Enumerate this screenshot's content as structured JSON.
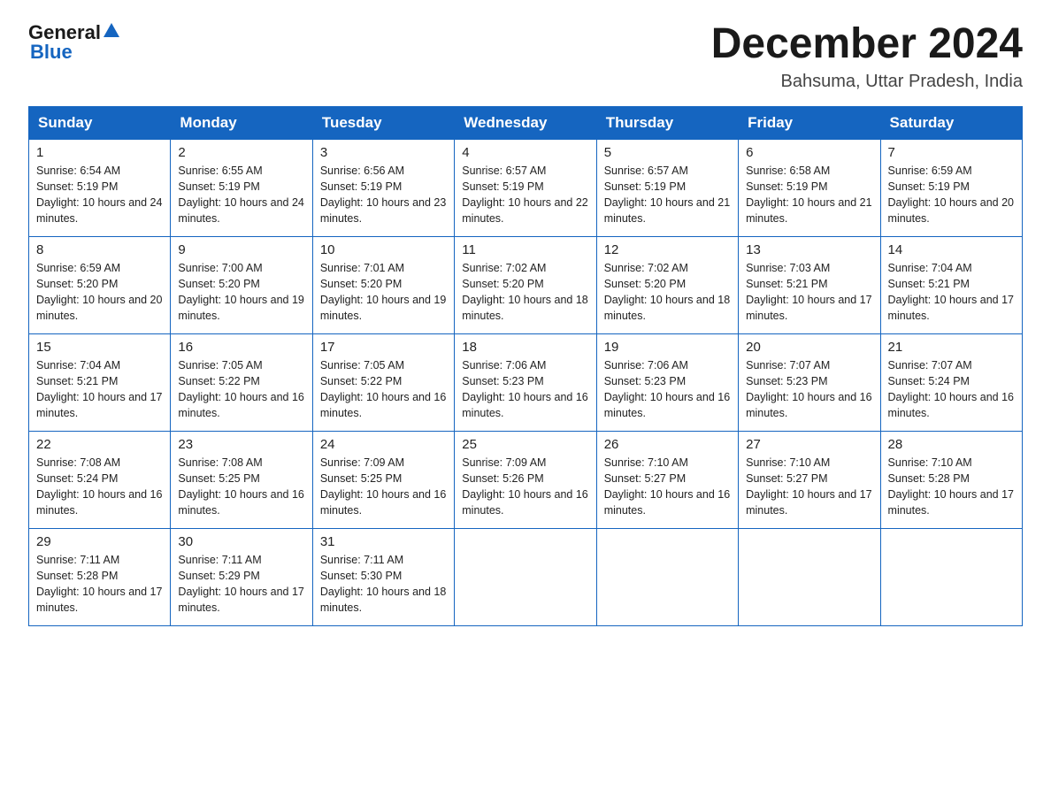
{
  "header": {
    "logo_general": "General",
    "logo_blue": "Blue",
    "title": "December 2024",
    "subtitle": "Bahsuma, Uttar Pradesh, India"
  },
  "days_of_week": [
    "Sunday",
    "Monday",
    "Tuesday",
    "Wednesday",
    "Thursday",
    "Friday",
    "Saturday"
  ],
  "weeks": [
    [
      {
        "day": "1",
        "sunrise": "6:54 AM",
        "sunset": "5:19 PM",
        "daylight": "10 hours and 24 minutes."
      },
      {
        "day": "2",
        "sunrise": "6:55 AM",
        "sunset": "5:19 PM",
        "daylight": "10 hours and 24 minutes."
      },
      {
        "day": "3",
        "sunrise": "6:56 AM",
        "sunset": "5:19 PM",
        "daylight": "10 hours and 23 minutes."
      },
      {
        "day": "4",
        "sunrise": "6:57 AM",
        "sunset": "5:19 PM",
        "daylight": "10 hours and 22 minutes."
      },
      {
        "day": "5",
        "sunrise": "6:57 AM",
        "sunset": "5:19 PM",
        "daylight": "10 hours and 21 minutes."
      },
      {
        "day": "6",
        "sunrise": "6:58 AM",
        "sunset": "5:19 PM",
        "daylight": "10 hours and 21 minutes."
      },
      {
        "day": "7",
        "sunrise": "6:59 AM",
        "sunset": "5:19 PM",
        "daylight": "10 hours and 20 minutes."
      }
    ],
    [
      {
        "day": "8",
        "sunrise": "6:59 AM",
        "sunset": "5:20 PM",
        "daylight": "10 hours and 20 minutes."
      },
      {
        "day": "9",
        "sunrise": "7:00 AM",
        "sunset": "5:20 PM",
        "daylight": "10 hours and 19 minutes."
      },
      {
        "day": "10",
        "sunrise": "7:01 AM",
        "sunset": "5:20 PM",
        "daylight": "10 hours and 19 minutes."
      },
      {
        "day": "11",
        "sunrise": "7:02 AM",
        "sunset": "5:20 PM",
        "daylight": "10 hours and 18 minutes."
      },
      {
        "day": "12",
        "sunrise": "7:02 AM",
        "sunset": "5:20 PM",
        "daylight": "10 hours and 18 minutes."
      },
      {
        "day": "13",
        "sunrise": "7:03 AM",
        "sunset": "5:21 PM",
        "daylight": "10 hours and 17 minutes."
      },
      {
        "day": "14",
        "sunrise": "7:04 AM",
        "sunset": "5:21 PM",
        "daylight": "10 hours and 17 minutes."
      }
    ],
    [
      {
        "day": "15",
        "sunrise": "7:04 AM",
        "sunset": "5:21 PM",
        "daylight": "10 hours and 17 minutes."
      },
      {
        "day": "16",
        "sunrise": "7:05 AM",
        "sunset": "5:22 PM",
        "daylight": "10 hours and 16 minutes."
      },
      {
        "day": "17",
        "sunrise": "7:05 AM",
        "sunset": "5:22 PM",
        "daylight": "10 hours and 16 minutes."
      },
      {
        "day": "18",
        "sunrise": "7:06 AM",
        "sunset": "5:23 PM",
        "daylight": "10 hours and 16 minutes."
      },
      {
        "day": "19",
        "sunrise": "7:06 AM",
        "sunset": "5:23 PM",
        "daylight": "10 hours and 16 minutes."
      },
      {
        "day": "20",
        "sunrise": "7:07 AM",
        "sunset": "5:23 PM",
        "daylight": "10 hours and 16 minutes."
      },
      {
        "day": "21",
        "sunrise": "7:07 AM",
        "sunset": "5:24 PM",
        "daylight": "10 hours and 16 minutes."
      }
    ],
    [
      {
        "day": "22",
        "sunrise": "7:08 AM",
        "sunset": "5:24 PM",
        "daylight": "10 hours and 16 minutes."
      },
      {
        "day": "23",
        "sunrise": "7:08 AM",
        "sunset": "5:25 PM",
        "daylight": "10 hours and 16 minutes."
      },
      {
        "day": "24",
        "sunrise": "7:09 AM",
        "sunset": "5:25 PM",
        "daylight": "10 hours and 16 minutes."
      },
      {
        "day": "25",
        "sunrise": "7:09 AM",
        "sunset": "5:26 PM",
        "daylight": "10 hours and 16 minutes."
      },
      {
        "day": "26",
        "sunrise": "7:10 AM",
        "sunset": "5:27 PM",
        "daylight": "10 hours and 16 minutes."
      },
      {
        "day": "27",
        "sunrise": "7:10 AM",
        "sunset": "5:27 PM",
        "daylight": "10 hours and 17 minutes."
      },
      {
        "day": "28",
        "sunrise": "7:10 AM",
        "sunset": "5:28 PM",
        "daylight": "10 hours and 17 minutes."
      }
    ],
    [
      {
        "day": "29",
        "sunrise": "7:11 AM",
        "sunset": "5:28 PM",
        "daylight": "10 hours and 17 minutes."
      },
      {
        "day": "30",
        "sunrise": "7:11 AM",
        "sunset": "5:29 PM",
        "daylight": "10 hours and 17 minutes."
      },
      {
        "day": "31",
        "sunrise": "7:11 AM",
        "sunset": "5:30 PM",
        "daylight": "10 hours and 18 minutes."
      },
      null,
      null,
      null,
      null
    ]
  ]
}
